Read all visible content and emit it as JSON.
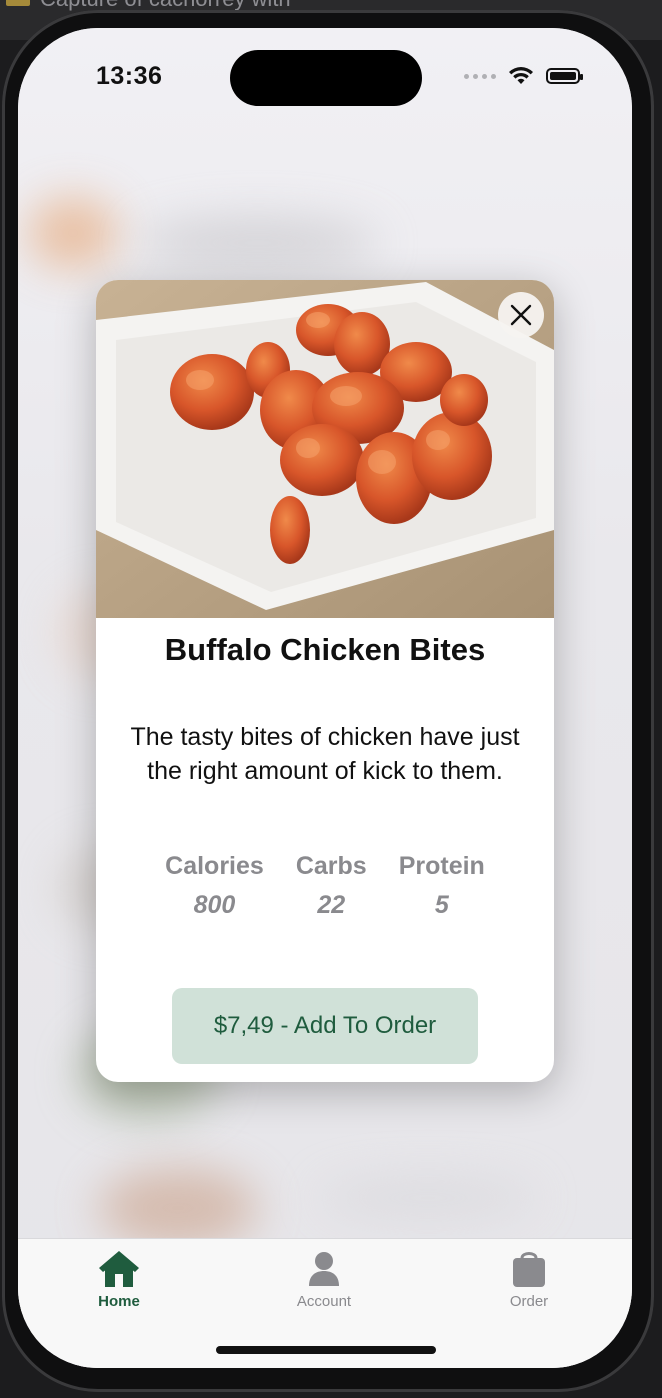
{
  "status_bar": {
    "time": "13:36"
  },
  "modal": {
    "title": "Buffalo Chicken Bites",
    "description": "The tasty bites of chicken have just the right amount of kick to them.",
    "stats": [
      {
        "label": "Calories",
        "value": "800"
      },
      {
        "label": "Carbs",
        "value": "22"
      },
      {
        "label": "Protein",
        "value": "5"
      }
    ],
    "add_button_label": "$7,49 - Add To Order",
    "close_icon": "close-icon"
  },
  "tab_bar": {
    "tabs": [
      {
        "label": "Home",
        "icon": "house-icon",
        "active": true
      },
      {
        "label": "Account",
        "icon": "person-icon",
        "active": false
      },
      {
        "label": "Order",
        "icon": "bag-icon",
        "active": false
      }
    ]
  },
  "colors": {
    "accent_green": "#1f5c3e",
    "button_bg": "#d0e1d8",
    "inactive_gray": "#8a8a8e"
  }
}
